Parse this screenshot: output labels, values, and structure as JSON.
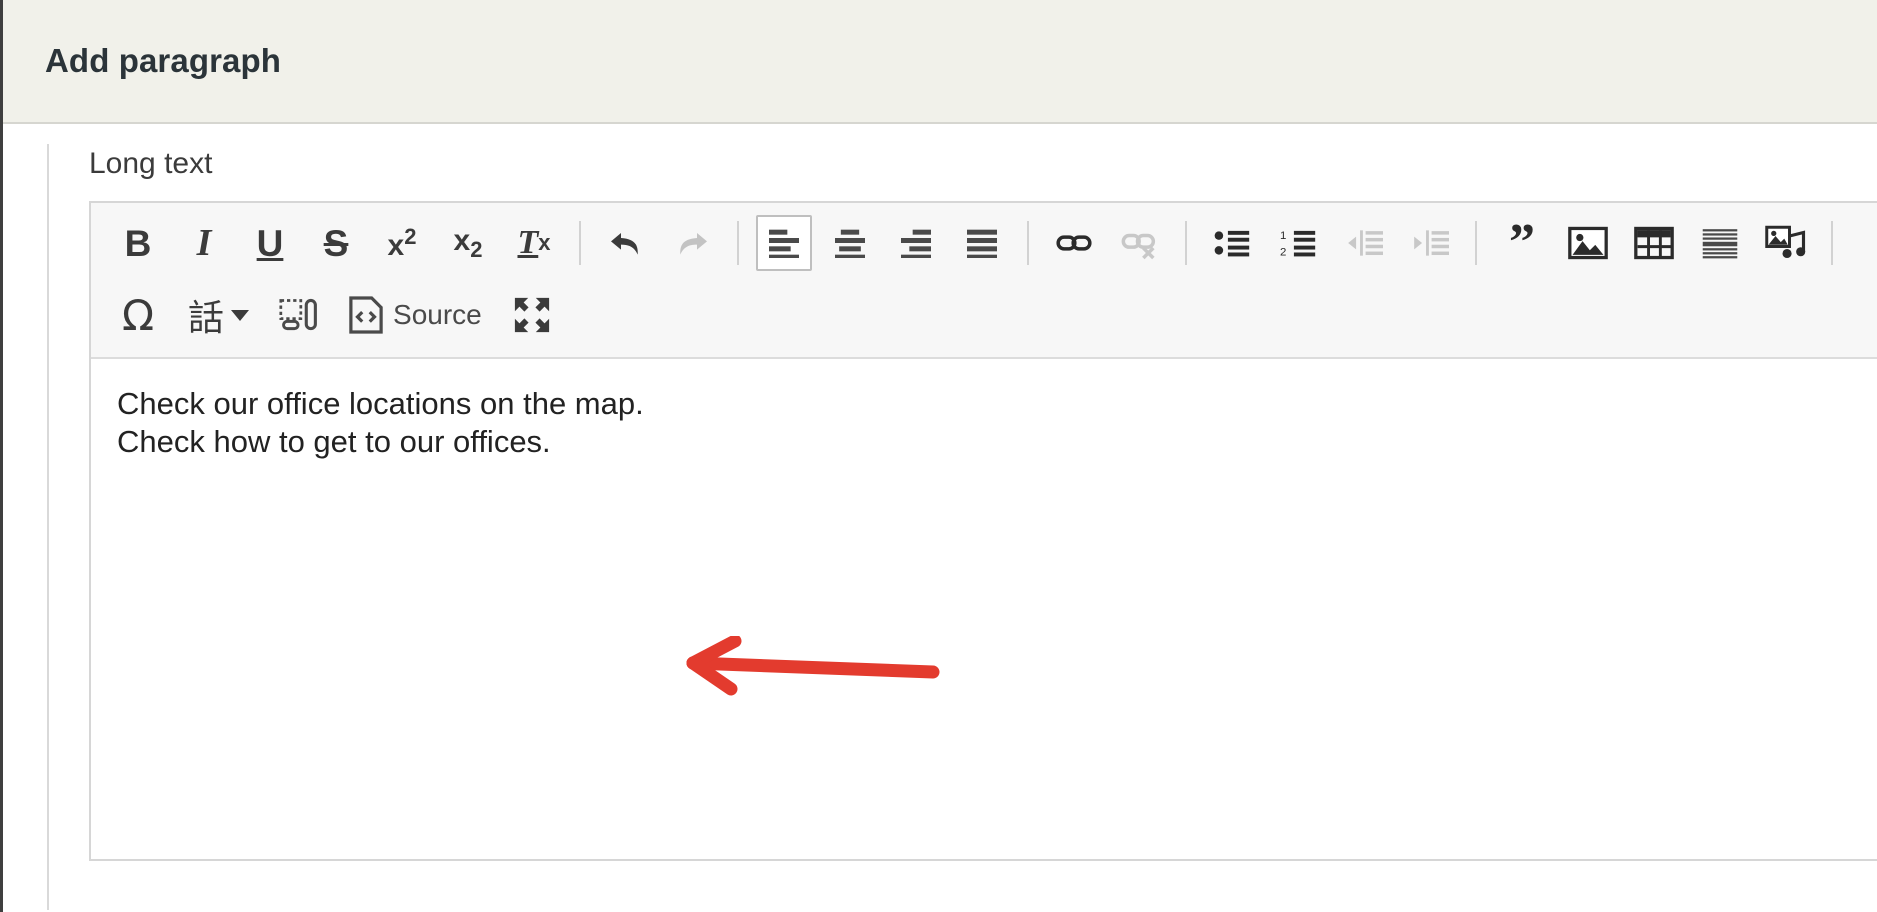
{
  "dialog": {
    "title": "Add paragraph"
  },
  "field": {
    "label": "Long text"
  },
  "editor": {
    "toolbar_rows": [
      [
        {
          "name": "bold-icon",
          "label": "B",
          "style": "bold",
          "state": "enabled"
        },
        {
          "name": "italic-icon",
          "label": "I",
          "style": "italic",
          "state": "enabled"
        },
        {
          "name": "underline-icon",
          "label": "U",
          "style": "underline",
          "state": "enabled"
        },
        {
          "name": "strikethrough-icon",
          "label": "S",
          "style": "strike",
          "state": "enabled"
        },
        {
          "name": "superscript-icon",
          "label": "x2",
          "style": "sup",
          "state": "enabled"
        },
        {
          "name": "subscript-icon",
          "label": "x2",
          "style": "sub",
          "state": "enabled"
        },
        {
          "name": "remove-format-icon",
          "label": "Tx",
          "style": "removeformat",
          "state": "enabled"
        },
        {
          "name": "separator",
          "style": "sep"
        },
        {
          "name": "undo-icon",
          "style": "undo",
          "state": "enabled"
        },
        {
          "name": "redo-icon",
          "style": "redo",
          "state": "disabled"
        },
        {
          "name": "separator",
          "style": "sep"
        },
        {
          "name": "align-left-icon",
          "style": "align-left",
          "state": "active"
        },
        {
          "name": "align-center-icon",
          "style": "align-center",
          "state": "enabled"
        },
        {
          "name": "align-right-icon",
          "style": "align-right",
          "state": "enabled"
        },
        {
          "name": "align-justify-icon",
          "style": "align-justify",
          "state": "enabled"
        },
        {
          "name": "separator",
          "style": "sep"
        },
        {
          "name": "link-icon",
          "style": "link",
          "state": "enabled"
        },
        {
          "name": "unlink-icon",
          "style": "unlink",
          "state": "disabled"
        },
        {
          "name": "separator",
          "style": "sep"
        },
        {
          "name": "bulleted-list-icon",
          "style": "ul",
          "state": "enabled"
        },
        {
          "name": "numbered-list-icon",
          "style": "ol",
          "state": "enabled"
        },
        {
          "name": "decrease-indent-icon",
          "style": "outdent",
          "state": "disabled"
        },
        {
          "name": "increase-indent-icon",
          "style": "indent",
          "state": "disabled"
        },
        {
          "name": "separator",
          "style": "sep"
        },
        {
          "name": "blockquote-icon",
          "label": "”",
          "style": "quote",
          "state": "enabled"
        },
        {
          "name": "image-icon",
          "style": "image",
          "state": "enabled"
        },
        {
          "name": "table-icon",
          "style": "table",
          "state": "enabled"
        },
        {
          "name": "horizontal-rule-icon",
          "style": "hr",
          "state": "enabled"
        },
        {
          "name": "media-icon",
          "style": "media",
          "state": "enabled"
        },
        {
          "name": "separator",
          "style": "sep"
        }
      ],
      [
        {
          "name": "special-character-icon",
          "label": "Ω",
          "style": "omega",
          "state": "enabled"
        },
        {
          "name": "language-icon",
          "label": "話",
          "style": "language-dropdown",
          "state": "enabled"
        },
        {
          "name": "show-blocks-icon",
          "style": "showblocks",
          "state": "enabled"
        },
        {
          "name": "source-button",
          "label": "Source",
          "style": "source",
          "state": "enabled"
        },
        {
          "name": "maximize-icon",
          "style": "maximize",
          "state": "enabled"
        }
      ]
    ],
    "content_lines": [
      "Check our office locations on the map.",
      "Check how to get to our offices."
    ]
  },
  "annotation": {
    "type": "arrow",
    "direction": "left",
    "color": "#e33b2e"
  },
  "colors": {
    "header_bg": "#f1f1ea",
    "toolbar_bg": "#f7f7f7",
    "title_text": "#2b3439",
    "body_text": "#222222",
    "arrow": "#e33b2e"
  }
}
